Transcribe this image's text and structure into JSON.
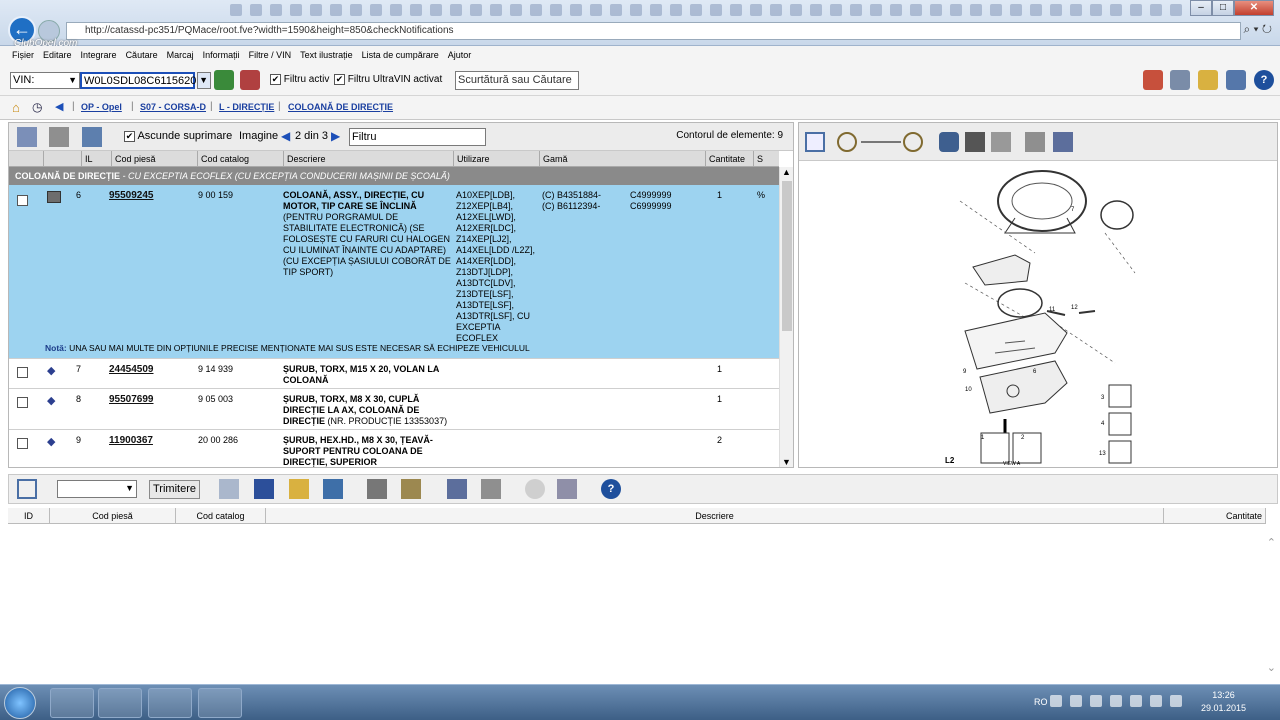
{
  "browser": {
    "url": "http://catassd-pc351/PQMace/root.fve?width=1590&height=850&checkNotifications",
    "watermark": "ClubOpel.com",
    "tools": "⌕ ▾ ↻"
  },
  "menu": [
    "Fișier",
    "Editare",
    "Integrare",
    "Căutare",
    "Marcaj",
    "Informații",
    "Filtre / VIN",
    "Text ilustrație",
    "Lista de cumpărare",
    "Ajutor"
  ],
  "vinbar": {
    "type_value": "VIN:",
    "vin_value": "W0L0SDL08C6115620",
    "filter_active": "Filtru activ",
    "filter_ultravin": "Filtru UltraVIN activat",
    "search_placeholder": "Scurtătură sau Căutare"
  },
  "breadcrumb": [
    "OP - Opel",
    "S07 - CORSA-D",
    "L - DIRECȚIE",
    "COLOANĂ DE DIRECȚIE"
  ],
  "parts": {
    "hide_deleted": "Ascunde suprimare",
    "image_label": "Imagine",
    "image_pos": "2 din 3",
    "filter_placeholder": "Filtru",
    "count_label": "Contorul de elemente: 9",
    "columns": [
      "IL",
      "Cod piesă",
      "Cod catalog",
      "Descriere",
      "Utilizare",
      "Gamă",
      "Cantitate",
      "S"
    ],
    "group_title": "COLOANĂ DE DIRECȚIE",
    "group_note": " - CU EXCEPTIA ECOFLEX (CU EXCEPȚIA CONDUCERII MAȘINII DE ȘCOALĂ)",
    "rows": [
      {
        "il": "6",
        "part": "95509245",
        "catalog": "9 00 159",
        "desc_bold": "COLOANĂ, ASSY., DIRECȚIE, CU MOTOR, TIP CARE SE ÎNCLINĂ",
        "desc_rest": "(PENTRU PORGRAMUL DE STABILITATE ELECTRONICĂ) (SE FOLOSEȘTE CU FARURI CU HALOGEN CU ILUMINAT ÎNAINTE CU ADAPTARE) (CU EXCEPȚIA ȘASIULUI COBORÂT DE TIP SPORT)",
        "usage": "A10XEP[LDB], Z12XEP[LB4], A12XEL[LWD], A12XER[LDC], Z14XEP[LJ2], A14XEL[LDD /L2Z], A14XER[LDD], Z13DTJ[LDP], A13DTC[LDV], Z13DTE[LSF], A13DTE[LSF], A13DTR[LSF], CU EXCEPTIA ECOFLEX",
        "range1": "(C) B4351884-",
        "range2": "(C) B6112394-",
        "range3": "C4999999",
        "range4": "C6999999",
        "qty": "1",
        "s": "%",
        "note_label": "Notă:",
        "note": "UNA SAU MAI MULTE DIN OPȚIUNILE PRECISE MENȚIONATE MAI SUS ESTE NECESAR SĂ ECHIPEZE VEHICULUL"
      },
      {
        "il": "7",
        "part": "24454509",
        "catalog": "9 14 939",
        "desc_bold": "ȘURUB, TORX, M15 X 20, VOLAN LA COLOANĂ",
        "desc_rest": "",
        "qty": "1"
      },
      {
        "il": "8",
        "part": "95507699",
        "catalog": "9 05 003",
        "desc_bold": "ȘURUB, TORX, M8 X 30, CUPLĂ DIRECȚIE LA AX, COLOANĂ DE DIRECȚIE",
        "desc_rest": "(NR. PRODUCȚIE 13353037)",
        "qty": "1"
      },
      {
        "il": "9",
        "part": "11900367",
        "catalog": "20 00 286",
        "desc_bold": "ȘURUB, HEX.HD., M8 X 30, ȚEAVĂ-SUPORT PENTRU COLOANA DE DIRECȚIE, SUPERIOR",
        "desc_rest": "",
        "qty": "2"
      }
    ]
  },
  "diagram": {
    "label": "L2",
    "view_label": "VIEW A",
    "callouts": [
      "7",
      "11",
      "12",
      "9",
      "10",
      "4",
      "3",
      "1",
      "2",
      "13",
      "6"
    ]
  },
  "cart": {
    "send_label": "Trimitere",
    "columns": [
      "ID",
      "Cod piesă",
      "Cod catalog",
      "Descriere",
      "Cantitate"
    ]
  },
  "taskbar": {
    "lang": "RO",
    "time": "13:26",
    "date": "29.01.2015"
  }
}
